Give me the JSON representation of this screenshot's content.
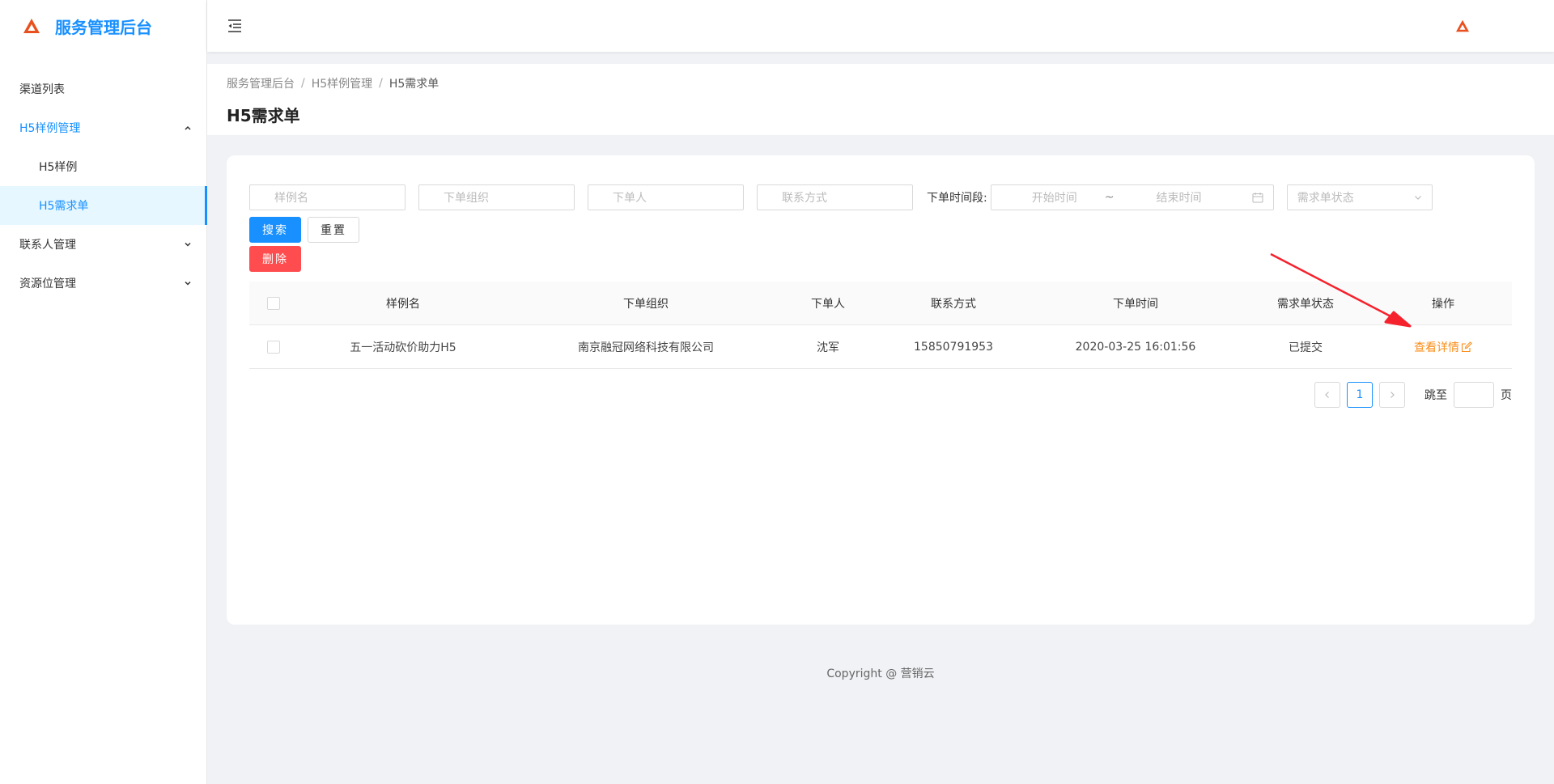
{
  "app": {
    "title": "服务管理后台"
  },
  "sidebar": {
    "items": [
      {
        "label": "渠道列表"
      },
      {
        "label": "H5样例管理"
      },
      {
        "label": "H5样例"
      },
      {
        "label": "H5需求单"
      },
      {
        "label": "联系人管理"
      },
      {
        "label": "资源位管理"
      }
    ]
  },
  "breadcrumb": [
    "服务管理后台",
    "H5样例管理",
    "H5需求单"
  ],
  "page": {
    "title": "H5需求单"
  },
  "filters": {
    "sample_name": "样例名",
    "org": "下单组织",
    "person": "下单人",
    "contact": "联系方式",
    "time_label": "下单时间段:",
    "start": "开始时间",
    "tilde": "~",
    "end": "结束时间",
    "status": "需求单状态"
  },
  "buttons": {
    "search": "搜索",
    "reset": "重置",
    "delete": "删除"
  },
  "table": {
    "headers": [
      "样例名",
      "下单组织",
      "下单人",
      "联系方式",
      "下单时间",
      "需求单状态",
      "操作"
    ],
    "rows": [
      {
        "name": "五一活动砍价助力H5",
        "org": "南京融冠网络科技有限公司",
        "person": "沈军",
        "phone": "15850791953",
        "time": "2020-03-25 16:01:56",
        "status": "已提交",
        "action": "查看详情"
      }
    ]
  },
  "pagination": {
    "current": "1",
    "jump_label": "跳至",
    "page_label": "页"
  },
  "footer": {
    "copyright": "Copyright @ 营销云"
  },
  "colors": {
    "primary": "#1890ff",
    "danger": "#ff4d4f",
    "link": "#fa8c16",
    "logo": "#e8501e",
    "annotation": "#f5222d"
  },
  "icons": {
    "logo": "triangle-logo-icon",
    "fold": "menu-fold-icon",
    "calendar": "calendar-icon",
    "select": "chevron-down-icon",
    "edit": "edit-icon"
  }
}
